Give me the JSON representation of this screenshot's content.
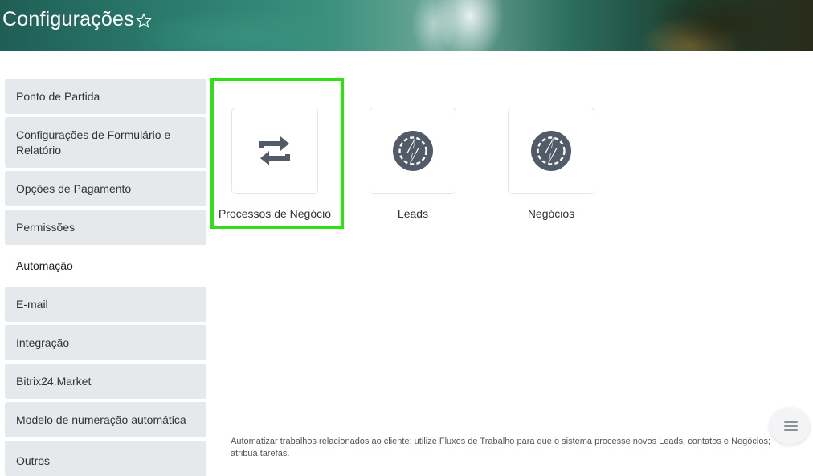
{
  "header": {
    "title": "Configurações"
  },
  "sidebar": {
    "items": [
      {
        "label": "Ponto de Partida"
      },
      {
        "label": "Configurações de Formulário e Relatório"
      },
      {
        "label": "Opções de Pagamento"
      },
      {
        "label": "Permissões"
      },
      {
        "label": "Automação",
        "active": true
      },
      {
        "label": "E-mail"
      },
      {
        "label": "Integração"
      },
      {
        "label": "Bitrix24.Market"
      },
      {
        "label": "Modelo de numeração automática"
      },
      {
        "label": "Outros"
      }
    ]
  },
  "main": {
    "tiles": [
      {
        "label": "Processos de Negócio",
        "icon": "refresh-arrows-icon",
        "selected": true
      },
      {
        "label": "Leads",
        "icon": "gear-lightning-icon"
      },
      {
        "label": "Negócios",
        "icon": "gear-lightning-icon"
      }
    ],
    "description": "Automatizar trabalhos relacionados ao cliente: utilize Fluxos de Trabalho para que o sistema processe novos Leads, contatos e Negócios; atribua tarefas."
  },
  "colors": {
    "highlight": "#2ee113",
    "icon": "#525c69",
    "sidebar_bg": "#e5e9ec"
  },
  "fab": {
    "icon": "list-icon"
  }
}
